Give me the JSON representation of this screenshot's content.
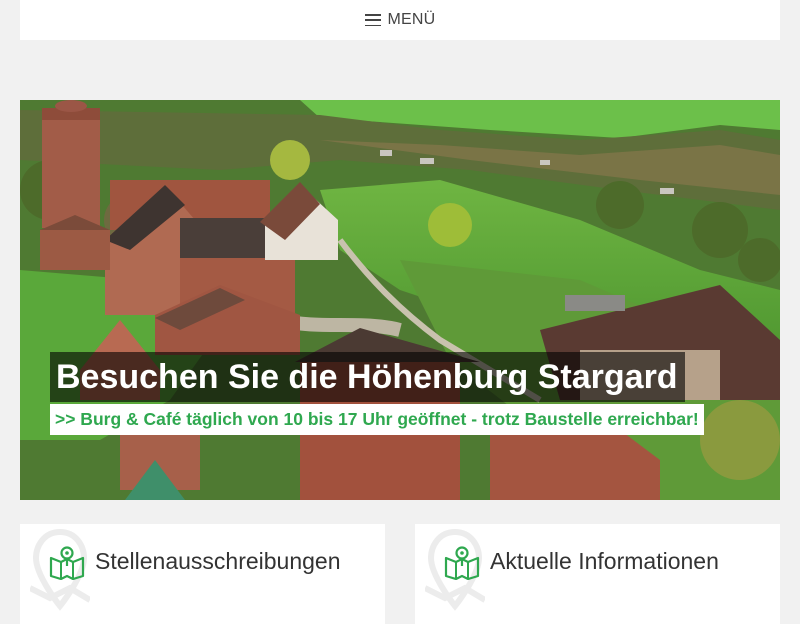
{
  "nav": {
    "menu_label": "MENÜ",
    "menu_icon": "hamburger-icon"
  },
  "hero": {
    "title": "Besuchen Sie die Höhenburg Stargard",
    "subtitle": ">> Burg & Café täglich von 10 bis 17 Uhr geöffnet - trotz Baustelle erreichbar!",
    "subtitle_color": "#2fa84f"
  },
  "cards": [
    {
      "title": "Stellenausschreibungen",
      "icon": "map-pin-icon"
    },
    {
      "title": "Aktuelle Informationen",
      "icon": "map-pin-icon"
    }
  ],
  "colors": {
    "accent": "#2fa84f",
    "page_bg": "#f1f1f1"
  }
}
